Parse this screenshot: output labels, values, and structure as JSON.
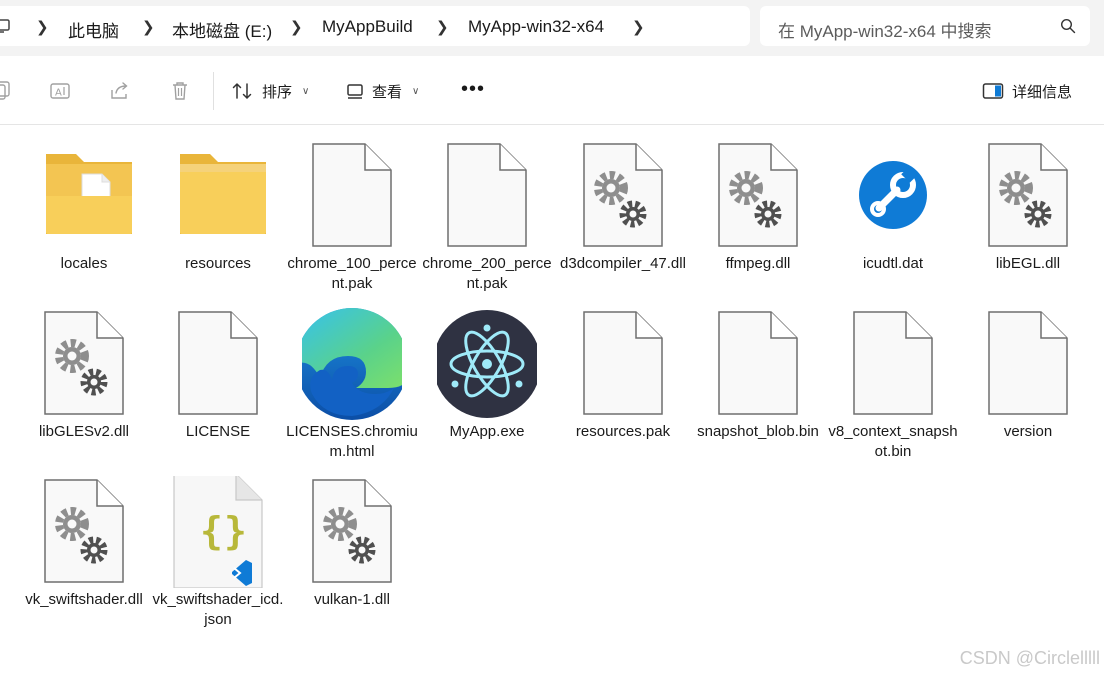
{
  "breadcrumb": {
    "items": [
      "此电脑",
      "本地磁盘 (E:)",
      "MyAppBuild",
      "MyApp-win32-x64"
    ]
  },
  "search": {
    "placeholder": "在 MyApp-win32-x64 中搜索"
  },
  "toolbar": {
    "sort_label": "排序",
    "view_label": "查看",
    "more_label": "•••",
    "details_label": "详细信息"
  },
  "files": [
    {
      "name": "locales",
      "icon": "folder-with-doc-icon"
    },
    {
      "name": "resources",
      "icon": "folder-icon"
    },
    {
      "name": "chrome_100_percent.pak",
      "icon": "blank-file-icon"
    },
    {
      "name": "chrome_200_percent.pak",
      "icon": "blank-file-icon"
    },
    {
      "name": "d3dcompiler_47.dll",
      "icon": "gear-file-icon"
    },
    {
      "name": "ffmpeg.dll",
      "icon": "gear-file-icon"
    },
    {
      "name": "icudtl.dat",
      "icon": "wrench-icon"
    },
    {
      "name": "libEGL.dll",
      "icon": "gear-file-icon"
    },
    {
      "name": "libGLESv2.dll",
      "icon": "gear-file-icon"
    },
    {
      "name": "LICENSE",
      "icon": "blank-file-icon"
    },
    {
      "name": "LICENSES.chromium.html",
      "icon": "edge-icon"
    },
    {
      "name": "MyApp.exe",
      "icon": "electron-icon"
    },
    {
      "name": "resources.pak",
      "icon": "blank-file-icon"
    },
    {
      "name": "snapshot_blob.bin",
      "icon": "blank-file-icon"
    },
    {
      "name": "v8_context_snapshot.bin",
      "icon": "blank-file-icon"
    },
    {
      "name": "version",
      "icon": "blank-file-icon"
    },
    {
      "name": "vk_swiftshader.dll",
      "icon": "gear-file-icon"
    },
    {
      "name": "vk_swiftshader_icd.json",
      "icon": "json-file-icon"
    },
    {
      "name": "vulkan-1.dll",
      "icon": "gear-file-icon"
    }
  ],
  "watermark": "CSDN @Circlelllll",
  "colors": {
    "folder": "#f8cf5a",
    "accent": "#0f7bd6",
    "edge_blue": "#1565c0",
    "electron_bg": "#2f3242"
  }
}
